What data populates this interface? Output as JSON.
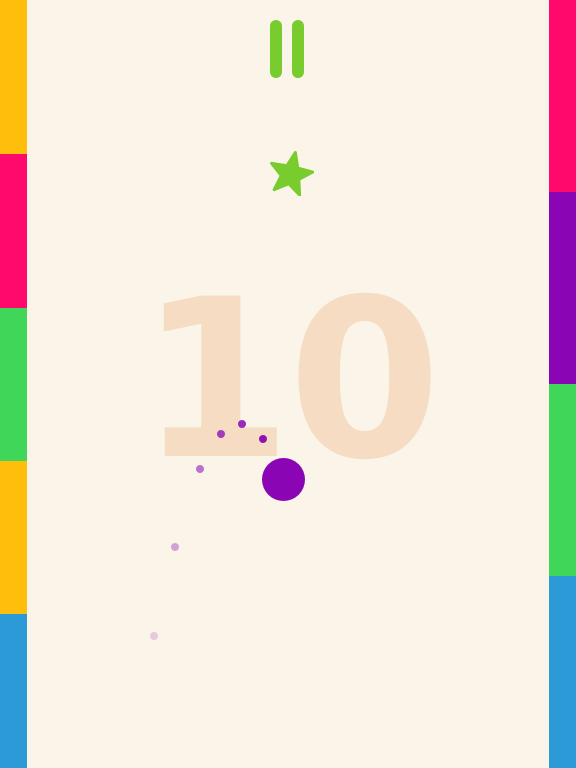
{
  "game": {
    "score": "10",
    "background_color": "#fbf4e8"
  },
  "hud": {
    "pause_icon": "pause-icon",
    "pause_color": "#79cc2e",
    "star_icon": "star-icon",
    "star_color": "#79cc2e"
  },
  "ball": {
    "color": "#8a06b4"
  },
  "walls": {
    "left": [
      "#ffbe0b",
      "#ff0a6c",
      "#3fd65a",
      "#ffbe0b",
      "#2b9ad6"
    ],
    "right": [
      "#ff0a6c",
      "#8a06b4",
      "#3fd65a",
      "#2b9ad6"
    ]
  },
  "trail_color": "#8a06b4"
}
